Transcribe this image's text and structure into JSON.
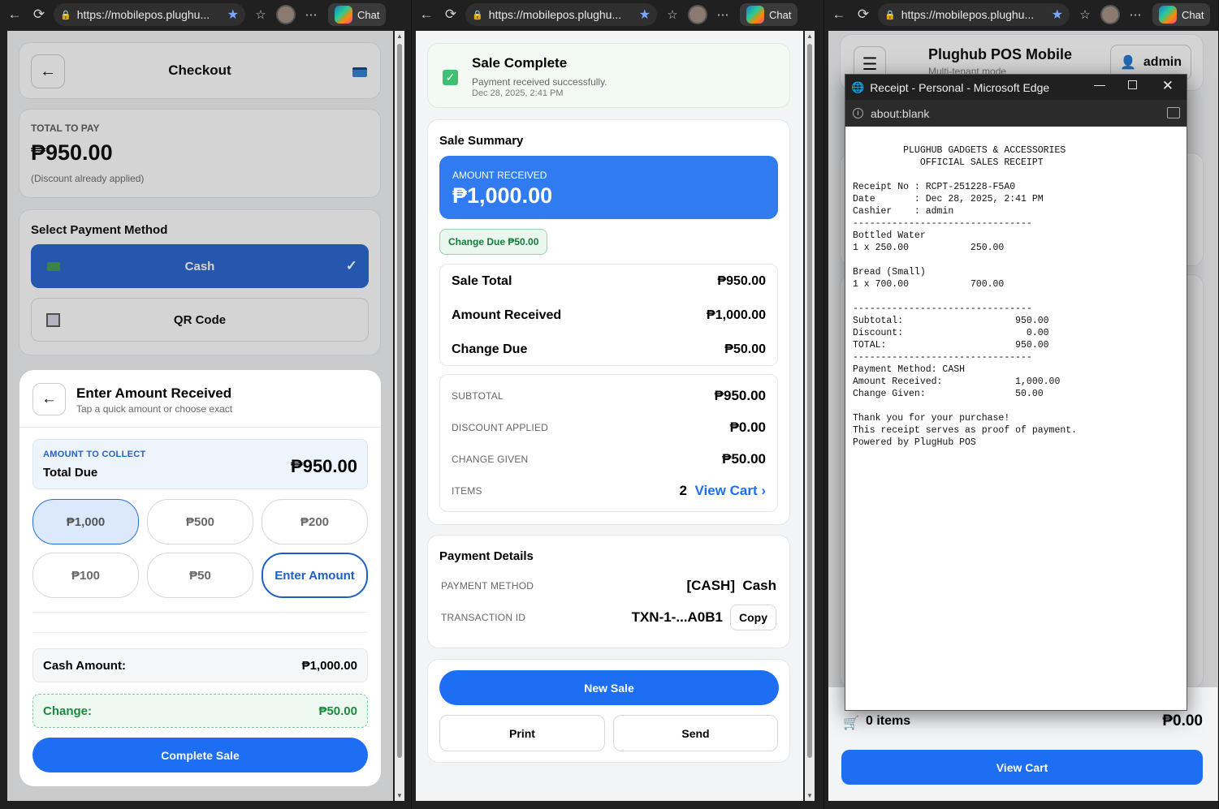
{
  "windows": [
    {
      "url": "https://mobilepos.plughu...",
      "chat": "Chat"
    },
    {
      "url": "https://mobilepos.plughu...",
      "chat": "Chat"
    },
    {
      "url": "https://mobilepos.plughu...",
      "chat": "Chat"
    }
  ],
  "checkout": {
    "back": "←",
    "title": "Checkout",
    "total_label": "TOTAL TO PAY",
    "total": "₱950.00",
    "discount_note": "(Discount already applied)",
    "method_title": "Select Payment Method",
    "methods": [
      "Cash",
      "QR Code"
    ],
    "check": "✓",
    "modal": {
      "back": "←",
      "title": "Enter Amount Received",
      "subtitle": "Tap a quick amount or choose exact",
      "collect_label": "AMOUNT TO COLLECT",
      "due_label": "Total Due",
      "due": "₱950.00",
      "quick": [
        "₱1,000",
        "₱500",
        "₱200",
        "₱100",
        "₱50",
        "Enter Amount"
      ],
      "cash_label": "Cash Amount:",
      "cash": "₱1,000.00",
      "change_label": "Change:",
      "change": "₱50.00",
      "complete": "Complete Sale"
    }
  },
  "sale": {
    "title": "Sale Complete",
    "msg": "Payment received successfully.",
    "date": "Dec 28, 2025, 2:41 PM",
    "summary_title": "Sale Summary",
    "received_label": "AMOUNT RECEIVED",
    "received": "₱1,000.00",
    "change_badge": "Change Due ₱50.00",
    "rows": [
      [
        "Sale Total",
        "₱950.00"
      ],
      [
        "Amount Received",
        "₱1,000.00"
      ],
      [
        "Change Due",
        "₱50.00"
      ]
    ],
    "details": [
      [
        "SUBTOTAL",
        "₱950.00"
      ],
      [
        "DISCOUNT APPLIED",
        "₱0.00"
      ],
      [
        "CHANGE GIVEN",
        "₱50.00"
      ]
    ],
    "items_label": "ITEMS",
    "items_count": "2",
    "view_cart": "View Cart ›",
    "pay_title": "Payment Details",
    "pm_label": "PAYMENT METHOD",
    "pm_value": "[CASH]  Cash",
    "tx_label": "TRANSACTION ID",
    "tx_value": "TXN-1-...A0B1",
    "copy": "Copy",
    "new_sale": "New Sale",
    "print": "Print",
    "send": "Send"
  },
  "pos": {
    "title": "Plughub POS Mobile",
    "mode": "Multi-tenant mode",
    "user": "admin",
    "items": "0 items",
    "total": "₱0.00",
    "view_cart": "View Cart"
  },
  "receipt_win": {
    "title": "Receipt - Personal - Microsoft Edge",
    "url": "about:blank",
    "lines": [
      "         PLUGHUB GADGETS & ACCESSORIES",
      "            OFFICIAL SALES RECEIPT",
      "",
      "Receipt No : RCPT-251228-F5A0",
      "Date       : Dec 28, 2025, 2:41 PM",
      "Cashier    : admin",
      "--------------------------------",
      "Bottled Water",
      "1 x 250.00           250.00",
      "",
      "Bread (Small)",
      "1 x 700.00           700.00",
      "",
      "--------------------------------",
      "Subtotal:                    950.00",
      "Discount:                      0.00",
      "TOTAL:                       950.00",
      "--------------------------------",
      "Payment Method: CASH",
      "Amount Received:             1,000.00",
      "Change Given:                50.00",
      "",
      "Thank you for your purchase!",
      "This receipt serves as proof of payment.",
      "Powered by PlugHub POS"
    ]
  }
}
